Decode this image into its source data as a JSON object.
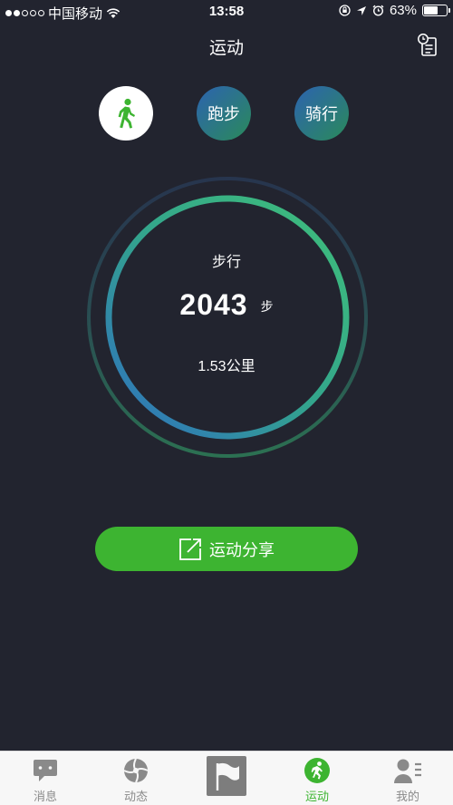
{
  "status_bar": {
    "carrier": "中国移动",
    "time": "13:58",
    "battery": "63%",
    "battery_level": 0.63,
    "signal_bars_filled": 2,
    "signal_bars_total": 5
  },
  "header": {
    "title": "运动"
  },
  "modes": [
    {
      "label": "",
      "icon": "walk-icon",
      "selected": true
    },
    {
      "label": "跑步",
      "selected": false
    },
    {
      "label": "骑行",
      "selected": false
    }
  ],
  "ring": {
    "mode_label": "步行",
    "steps": "2043",
    "steps_unit": "步",
    "distance": "1.53公里"
  },
  "share": {
    "label": "运动分享"
  },
  "tabs": [
    {
      "label": "消息",
      "icon": "message-icon",
      "active": false
    },
    {
      "label": "动态",
      "icon": "aperture-icon",
      "active": false
    },
    {
      "label": "",
      "icon": "flag-icon",
      "active": false
    },
    {
      "label": "运动",
      "icon": "running-icon",
      "active": true
    },
    {
      "label": "我的",
      "icon": "profile-icon",
      "active": false
    }
  ],
  "colors": {
    "background": "#22242f",
    "accent_green": "#3db431",
    "ring_blue": "#2f74c0",
    "ring_green": "#3fbf7a"
  }
}
